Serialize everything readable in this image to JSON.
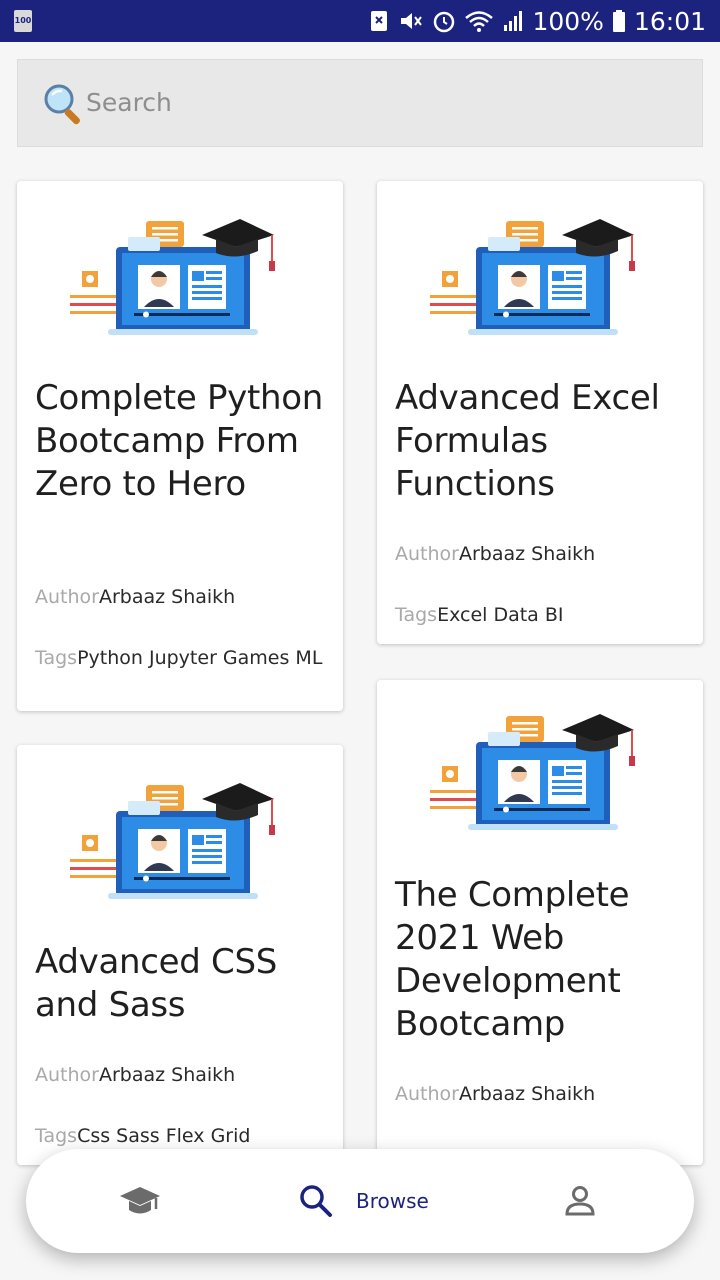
{
  "status_bar": {
    "battery_badge": "100",
    "battery_percent": "100%",
    "time": "16:01"
  },
  "search": {
    "placeholder": "Search"
  },
  "courses": [
    {
      "title": "Complete Python Bootcamp From Zero to Hero",
      "author_label": "Author",
      "author": "Arbaaz Shaikh",
      "tags_label": "Tags",
      "tags": "Python Jupyter Games ML"
    },
    {
      "title": "Advanced Excel Formulas Functions",
      "author_label": "Author",
      "author": "Arbaaz Shaikh",
      "tags_label": "Tags",
      "tags": "Excel Data BI"
    },
    {
      "title": "Advanced CSS and Sass",
      "author_label": "Author",
      "author": "Arbaaz Shaikh",
      "tags_label": "Tags",
      "tags": "Css Sass Flex Grid"
    },
    {
      "title": "The Complete 2021 Web Development Bootcamp",
      "author_label": "Author",
      "author": "Arbaaz Shaikh"
    }
  ],
  "bottom_nav": {
    "items": [
      {
        "icon": "graduation-cap-icon"
      },
      {
        "icon": "search-icon",
        "label": "Browse",
        "active": true
      },
      {
        "icon": "profile-icon"
      }
    ]
  },
  "colors": {
    "primary": "#1c237f",
    "card_bg": "#ffffff",
    "page_bg": "#f6f6f6"
  }
}
